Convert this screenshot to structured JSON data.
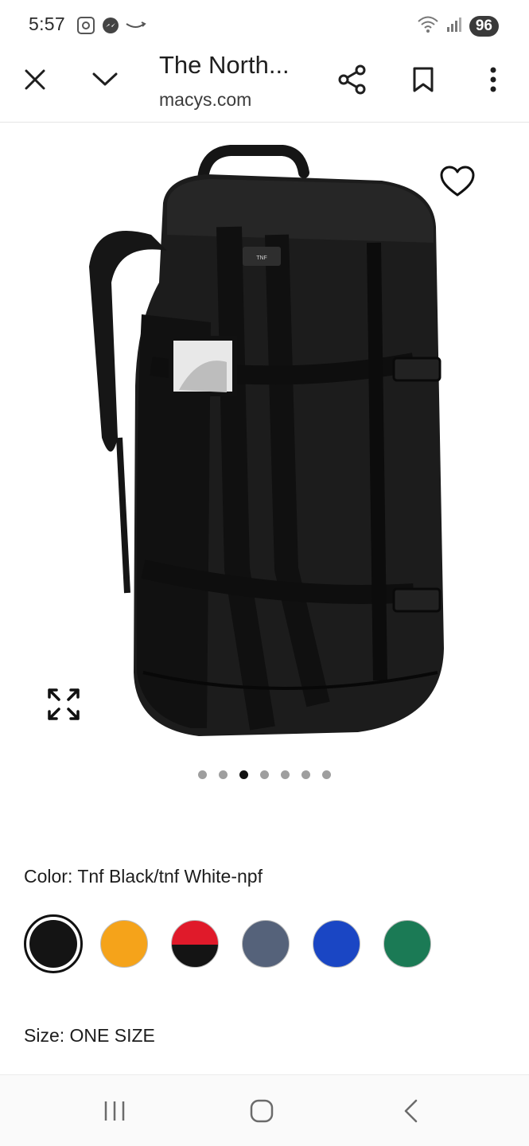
{
  "status_bar": {
    "time": "5:57",
    "battery": "96",
    "left_icons": [
      "screenshot-icon",
      "messenger-icon",
      "amazon-smile-icon"
    ],
    "right_icons": [
      "wifi-icon",
      "signal-icon"
    ]
  },
  "toolbar": {
    "page_title": "The North...",
    "domain": "macys.com",
    "icons": [
      "close-icon",
      "chevron-down-icon",
      "share-icon",
      "bookmark-icon",
      "more-vert-icon"
    ]
  },
  "product": {
    "image_subject": "backpack-duffel-image",
    "wishlist_icon": "heart-icon",
    "expand_icon": "expand-icon",
    "carousel": {
      "total": 7,
      "active_index": 2
    }
  },
  "color": {
    "label": "Color: Tnf Black/tnf White-npf",
    "swatches": [
      {
        "name": "swatch-black",
        "color": "#141414",
        "selected": true
      },
      {
        "name": "swatch-orange",
        "color": "#f5a31a",
        "selected": false
      },
      {
        "name": "swatch-red-black",
        "color": "#e01a2a",
        "color2": "#141414",
        "selected": false
      },
      {
        "name": "swatch-heather-navy",
        "color": "#55627a",
        "selected": false
      },
      {
        "name": "swatch-blue",
        "color": "#1a46c4",
        "selected": false
      },
      {
        "name": "swatch-green",
        "color": "#1b7a55",
        "selected": false
      }
    ]
  },
  "size": {
    "label": "Size: ONE SIZE"
  },
  "navbar": {
    "icons": [
      "recent-apps-icon",
      "home-icon",
      "back-icon"
    ]
  }
}
